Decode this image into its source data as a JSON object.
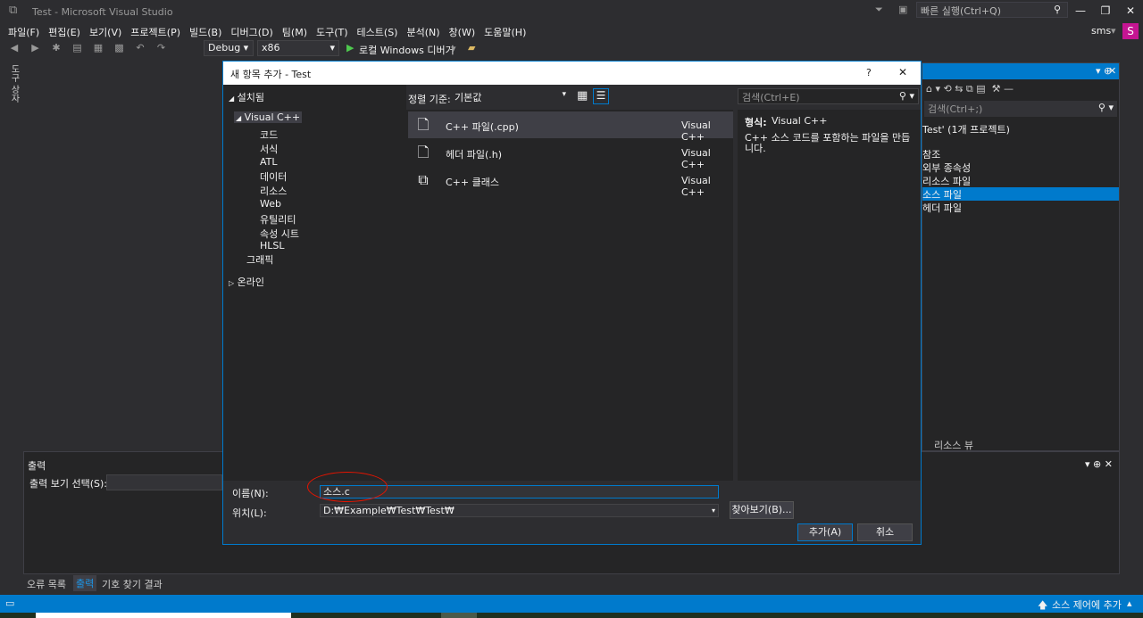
{
  "window": {
    "title": "Test - Microsoft Visual Studio",
    "quick_launch": "빠른 실행(Ctrl+Q)",
    "user": "sms",
    "user_initial": "S"
  },
  "menu": [
    "파일(F)",
    "편집(E)",
    "보기(V)",
    "프로젝트(P)",
    "빌드(B)",
    "디버그(D)",
    "팀(M)",
    "도구(T)",
    "테스트(S)",
    "분석(N)",
    "창(W)",
    "도움말(H)"
  ],
  "toolbar": {
    "config": "Debug",
    "platform": "x86",
    "run_label": "로컬 Windows 디버거"
  },
  "left_tool": "도구 상자",
  "solution_explorer": {
    "search": "검색(Ctrl+;)",
    "project": "Test' (1개 프로젝트)",
    "items": [
      "참조",
      "외부 종속성",
      "리소스 파일",
      "소스 파일",
      "헤더 파일"
    ],
    "selected_index": 3,
    "bottom_tab": "리소스 뷰"
  },
  "output_panel": {
    "title": "출력",
    "show_label": "출력 보기 선택(S):"
  },
  "bottom_tabs": [
    "오류 목록",
    "출력",
    "기호 찾기 결과"
  ],
  "status": {
    "right": "소스 제어에 추가"
  },
  "dialog": {
    "title": "새 항목 추가 - Test",
    "help": "?",
    "close": "✕",
    "installed": "설치됨",
    "tree": {
      "root": "Visual C++",
      "children": [
        "코드",
        "서식",
        "ATL",
        "데이터",
        "리소스",
        "Web",
        "유틸리티",
        "속성 시트",
        "HLSL"
      ],
      "graphics": "그래픽",
      "online": "온라인"
    },
    "sort_label": "정렬 기준:",
    "sort_value": "기본값",
    "search_placeholder": "검색(Ctrl+E)",
    "items": [
      {
        "name": "C++ 파일(.cpp)",
        "type": "Visual C++",
        "icon": "cpp-file-icon"
      },
      {
        "name": "헤더 파일(.h)",
        "type": "Visual C++",
        "icon": "header-file-icon"
      },
      {
        "name": "C++ 클래스",
        "type": "Visual C++",
        "icon": "class-icon"
      }
    ],
    "detail_type_label": "형식:",
    "detail_type": "Visual C++",
    "detail_desc": "C++ 소스 코드를 포함하는 파일을 만듭니다.",
    "name_label": "이름(N):",
    "name_value": "소스.c",
    "location_label": "위치(L):",
    "location_value": "D:₩Example₩Test₩Test₩",
    "browse": "찾아보기(B)...",
    "add": "추가(A)",
    "cancel": "취소"
  },
  "colors": {
    "accent": "#007acc",
    "annotation": "#e51400",
    "user_badge": "#c51592"
  }
}
